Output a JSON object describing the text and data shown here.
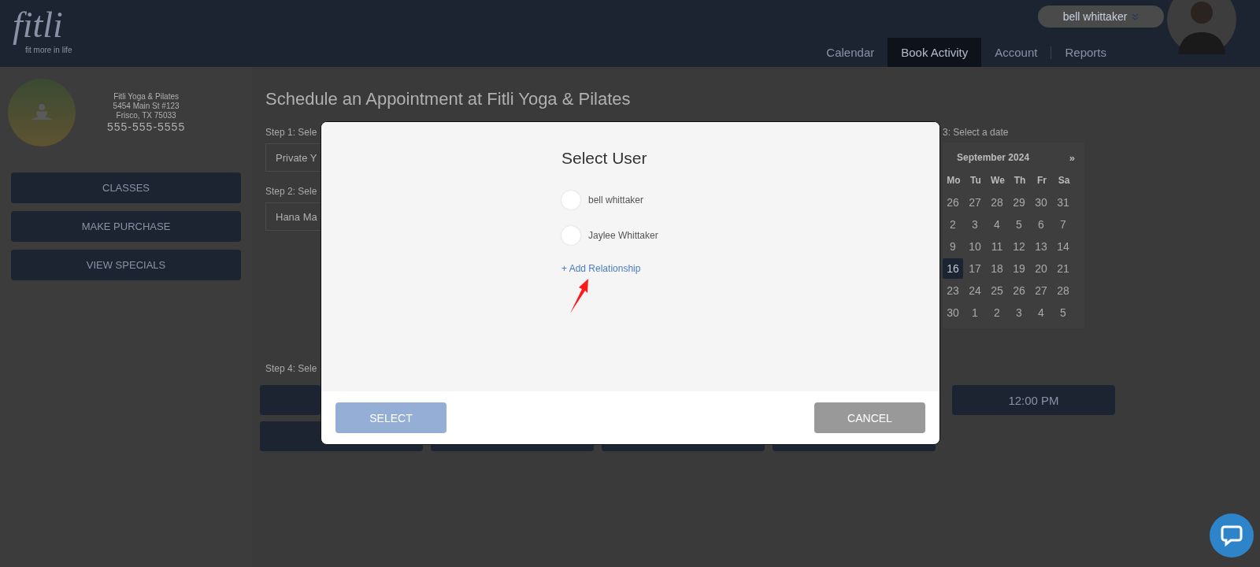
{
  "header": {
    "logo": {
      "wordmark": "fitli",
      "tagline": "fit more in life"
    },
    "user_menu": "bell whittaker",
    "nav": [
      {
        "label": "Calendar",
        "selected": false
      },
      {
        "label": "Book Activity",
        "selected": true
      },
      {
        "label": "Account",
        "selected": false
      },
      {
        "label": "Reports",
        "selected": false
      }
    ]
  },
  "sidebar": {
    "studio": {
      "name": "Fitli Yoga & Pilates",
      "street": "5454 Main St #123",
      "city": "Frisco, TX 75033",
      "phone": "555-555-5555"
    },
    "buttons": [
      "CLASSES",
      "MAKE PURCHASE",
      "VIEW SPECIALS"
    ]
  },
  "main": {
    "title": "Schedule an Appointment at Fitli Yoga & Pilates",
    "step1": {
      "label": "Step 1: Sele",
      "value": "Private Y"
    },
    "step2": {
      "label": "Step 2: Sele",
      "value": "Hana Ma"
    },
    "step3": {
      "label": "3: Select a date"
    },
    "calendar": {
      "month": "September 2024",
      "next": "»",
      "weekdays": [
        "Mo",
        "Tu",
        "We",
        "Th",
        "Fr",
        "Sa"
      ],
      "weeks": [
        [
          {
            "day": "26",
            "selected": false
          },
          {
            "day": "27",
            "selected": false
          },
          {
            "day": "28",
            "selected": false
          },
          {
            "day": "29",
            "selected": false
          },
          {
            "day": "30",
            "selected": false
          },
          {
            "day": "31",
            "selected": false
          }
        ],
        [
          {
            "day": "2",
            "selected": false
          },
          {
            "day": "3",
            "selected": false
          },
          {
            "day": "4",
            "selected": false
          },
          {
            "day": "5",
            "selected": false
          },
          {
            "day": "6",
            "selected": false
          },
          {
            "day": "7",
            "selected": false
          }
        ],
        [
          {
            "day": "9",
            "selected": false
          },
          {
            "day": "10",
            "selected": false
          },
          {
            "day": "11",
            "selected": false
          },
          {
            "day": "12",
            "selected": false
          },
          {
            "day": "13",
            "selected": false
          },
          {
            "day": "14",
            "selected": false
          }
        ],
        [
          {
            "day": "16",
            "selected": true
          },
          {
            "day": "17",
            "selected": false
          },
          {
            "day": "18",
            "selected": false
          },
          {
            "day": "19",
            "selected": false
          },
          {
            "day": "20",
            "selected": false
          },
          {
            "day": "21",
            "selected": false
          }
        ],
        [
          {
            "day": "23",
            "selected": false
          },
          {
            "day": "24",
            "selected": false
          },
          {
            "day": "25",
            "selected": false
          },
          {
            "day": "26",
            "selected": false
          },
          {
            "day": "27",
            "selected": false
          },
          {
            "day": "28",
            "selected": false
          }
        ],
        [
          {
            "day": "30",
            "selected": false
          },
          {
            "day": "1",
            "selected": false
          },
          {
            "day": "2",
            "selected": false
          },
          {
            "day": "3",
            "selected": false
          },
          {
            "day": "4",
            "selected": false
          },
          {
            "day": "5",
            "selected": false
          }
        ]
      ]
    },
    "step4": {
      "label": "Step 4: Sele"
    },
    "time_slots": [
      {
        "label": "12:00 PM"
      }
    ]
  },
  "modal": {
    "title": "Select User",
    "users": [
      {
        "name": "bell whittaker",
        "selected": false
      },
      {
        "name": "Jaylee Whittaker",
        "selected": false
      }
    ],
    "add_link": "+ Add Relationship",
    "select_button": {
      "label": "SELECT",
      "disabled": true
    },
    "cancel_button": {
      "label": "CANCEL"
    }
  }
}
